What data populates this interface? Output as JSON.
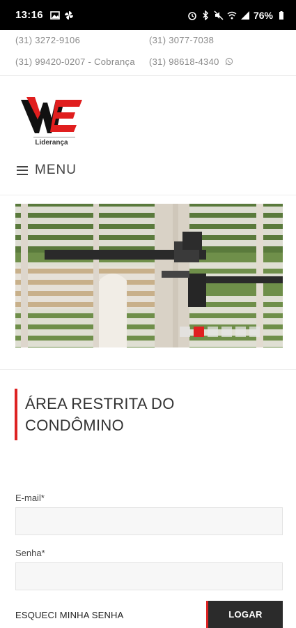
{
  "status_bar": {
    "time": "13:16",
    "battery": "76%"
  },
  "contacts": {
    "phone_1": "(31) 3272-9106",
    "phone_2": "(31) 3077-7038",
    "phone_3": "(31) 99420-0207 - Cobrança",
    "phone_4": "(31) 98618-4340"
  },
  "logo": {
    "text": "Liderança",
    "colors": {
      "red": "#e01e1e",
      "black": "#111111"
    }
  },
  "menu": {
    "label": "MENU"
  },
  "carousel": {
    "slide_count": 6,
    "active_index": 1
  },
  "section": {
    "title_line_1": "ÁREA RESTRITA DO",
    "title_line_2": "CONDÔMINO",
    "accent_color": "#dd2222"
  },
  "form": {
    "email_label": "E-mail*",
    "email_value": "",
    "password_label": "Senha*",
    "password_value": "",
    "forgot_label": "ESQUECI MINHA SENHA",
    "login_label": "LOGAR"
  }
}
